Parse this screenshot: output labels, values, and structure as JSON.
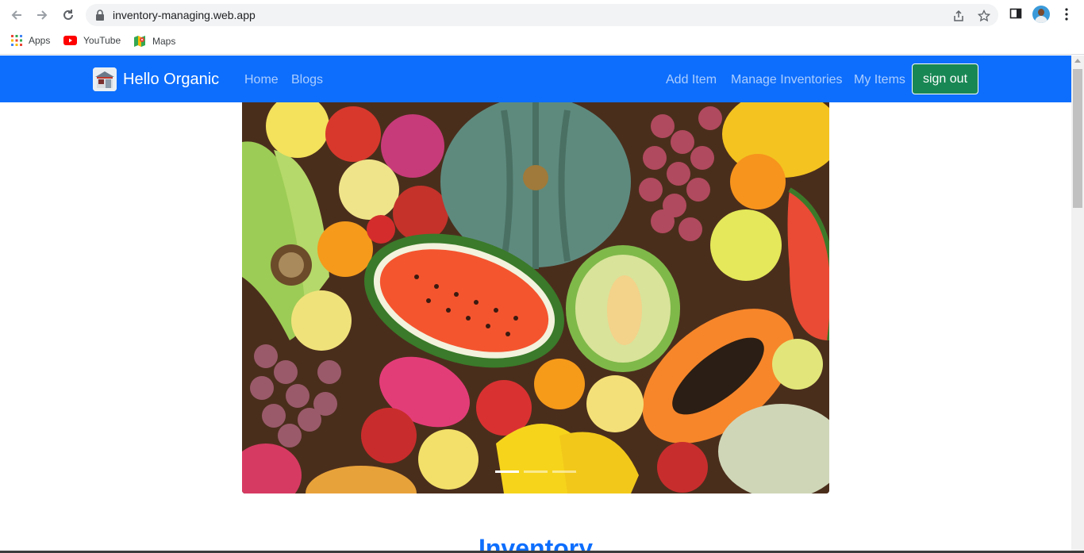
{
  "browser": {
    "url": "inventory-managing.web.app",
    "bookmarks": [
      {
        "label": "Apps",
        "icon": "apps-grid-icon"
      },
      {
        "label": "YouTube",
        "icon": "youtube-icon"
      },
      {
        "label": "Maps",
        "icon": "maps-icon"
      }
    ]
  },
  "navbar": {
    "brand": "Hello Organic",
    "left_links": [
      "Home",
      "Blogs"
    ],
    "right_links": [
      "Add Item",
      "Manage Inventories",
      "My Items"
    ],
    "signout_label": "sign out",
    "colors": {
      "navbar": "#0d6efd",
      "signout": "#198754"
    }
  },
  "carousel": {
    "slide_count": 3,
    "active_index": 0
  },
  "inventory": {
    "title": "Inventory"
  }
}
